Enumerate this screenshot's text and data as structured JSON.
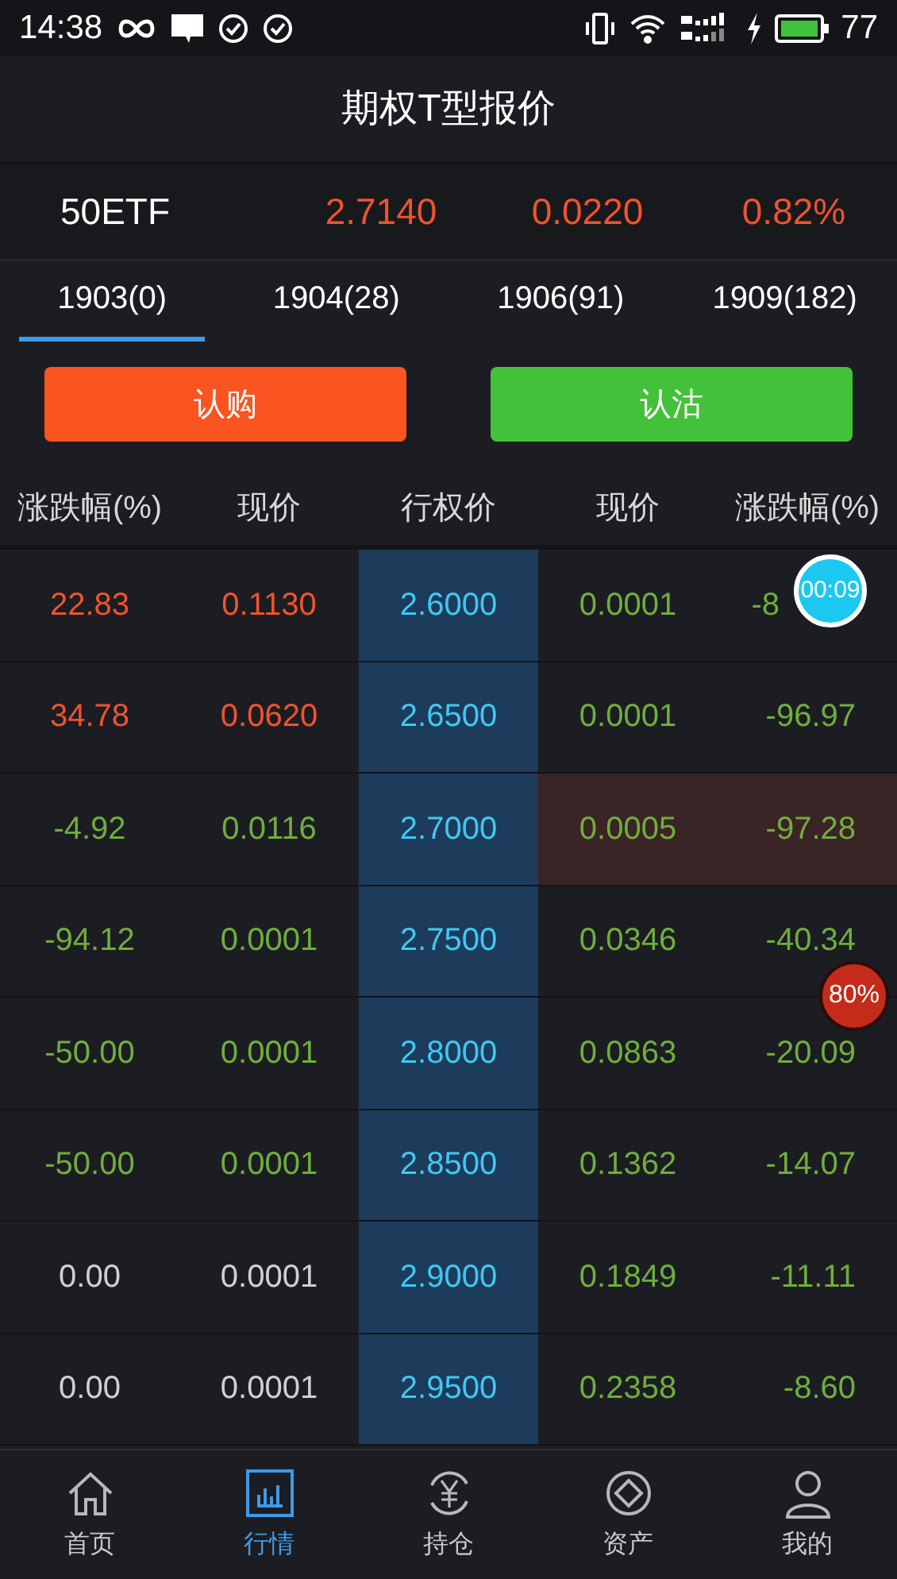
{
  "status_bar": {
    "time": "14:38",
    "battery": "77"
  },
  "header": {
    "title": "期权T型报价"
  },
  "quote": {
    "symbol": "50ETF",
    "price": "2.7140",
    "change": "0.0220",
    "percent": "0.82%",
    "color": "#f0532d"
  },
  "tabs": [
    {
      "label": "1903(0)",
      "selected": true
    },
    {
      "label": "1904(28)",
      "selected": false
    },
    {
      "label": "1906(91)",
      "selected": false
    },
    {
      "label": "1909(182)",
      "selected": false
    }
  ],
  "actions": [
    {
      "label": "认购",
      "kind": "call"
    },
    {
      "label": "认沽",
      "kind": "put"
    }
  ],
  "table": {
    "columns": [
      "涨跌幅(%)",
      "现价",
      "行权价",
      "现价",
      "涨跌幅(%)"
    ],
    "rows": [
      {
        "cells": [
          {
            "text": "22.83",
            "color": "#f0532d"
          },
          {
            "text": "0.1130",
            "color": "#f0532d"
          },
          {
            "text": "2.6000",
            "color": "#40c8f2"
          },
          {
            "text": "0.0001",
            "color": "#6fae3c"
          },
          {
            "text": "-8",
            "color": "#6fae3c",
            "clipped": true
          }
        ],
        "highlighted": false
      },
      {
        "cells": [
          {
            "text": "34.78",
            "color": "#f0532d"
          },
          {
            "text": "0.0620",
            "color": "#f0532d"
          },
          {
            "text": "2.6500",
            "color": "#40c8f2"
          },
          {
            "text": "0.0001",
            "color": "#6fae3c"
          },
          {
            "text": "-96.97",
            "color": "#6fae3c"
          }
        ],
        "highlighted": false
      },
      {
        "cells": [
          {
            "text": "-4.92",
            "color": "#6fae3c"
          },
          {
            "text": "0.0116",
            "color": "#6fae3c"
          },
          {
            "text": "2.7000",
            "color": "#40c8f2"
          },
          {
            "text": "0.0005",
            "color": "#6fae3c"
          },
          {
            "text": "-97.28",
            "color": "#6fae3c"
          }
        ],
        "highlighted": true
      },
      {
        "cells": [
          {
            "text": "-94.12",
            "color": "#6fae3c"
          },
          {
            "text": "0.0001",
            "color": "#6fae3c"
          },
          {
            "text": "2.7500",
            "color": "#40c8f2"
          },
          {
            "text": "0.0346",
            "color": "#6fae3c"
          },
          {
            "text": "-40.34",
            "color": "#6fae3c"
          }
        ],
        "highlighted": false
      },
      {
        "cells": [
          {
            "text": "-50.00",
            "color": "#6fae3c"
          },
          {
            "text": "0.0001",
            "color": "#6fae3c"
          },
          {
            "text": "2.8000",
            "color": "#40c8f2"
          },
          {
            "text": "0.0863",
            "color": "#6fae3c"
          },
          {
            "text": "-20.09",
            "color": "#6fae3c"
          }
        ],
        "highlighted": false
      },
      {
        "cells": [
          {
            "text": "-50.00",
            "color": "#6fae3c"
          },
          {
            "text": "0.0001",
            "color": "#6fae3c"
          },
          {
            "text": "2.8500",
            "color": "#40c8f2"
          },
          {
            "text": "0.1362",
            "color": "#6fae3c"
          },
          {
            "text": "-14.07",
            "color": "#6fae3c"
          }
        ],
        "highlighted": false
      },
      {
        "cells": [
          {
            "text": "0.00",
            "color": "#d0d0d0"
          },
          {
            "text": "0.0001",
            "color": "#d0d0d0"
          },
          {
            "text": "2.9000",
            "color": "#40c8f2"
          },
          {
            "text": "0.1849",
            "color": "#6fae3c"
          },
          {
            "text": "-11.11",
            "color": "#6fae3c"
          }
        ],
        "highlighted": false
      },
      {
        "cells": [
          {
            "text": "0.00",
            "color": "#d0d0d0"
          },
          {
            "text": "0.0001",
            "color": "#d0d0d0"
          },
          {
            "text": "2.9500",
            "color": "#40c8f2"
          },
          {
            "text": "0.2358",
            "color": "#6fae3c"
          },
          {
            "text": "-8.60",
            "color": "#6fae3c"
          }
        ],
        "highlighted": false
      }
    ]
  },
  "timer_bubble": "00:09",
  "progress_bubble": "80%",
  "nav": [
    {
      "label": "首页",
      "kind": "home",
      "selected": false
    },
    {
      "label": "行情",
      "kind": "chart",
      "selected": true
    },
    {
      "label": "持仓",
      "kind": "yen",
      "selected": false
    },
    {
      "label": "资产",
      "kind": "asset",
      "selected": false
    },
    {
      "label": "我的",
      "kind": "user",
      "selected": false
    }
  ]
}
